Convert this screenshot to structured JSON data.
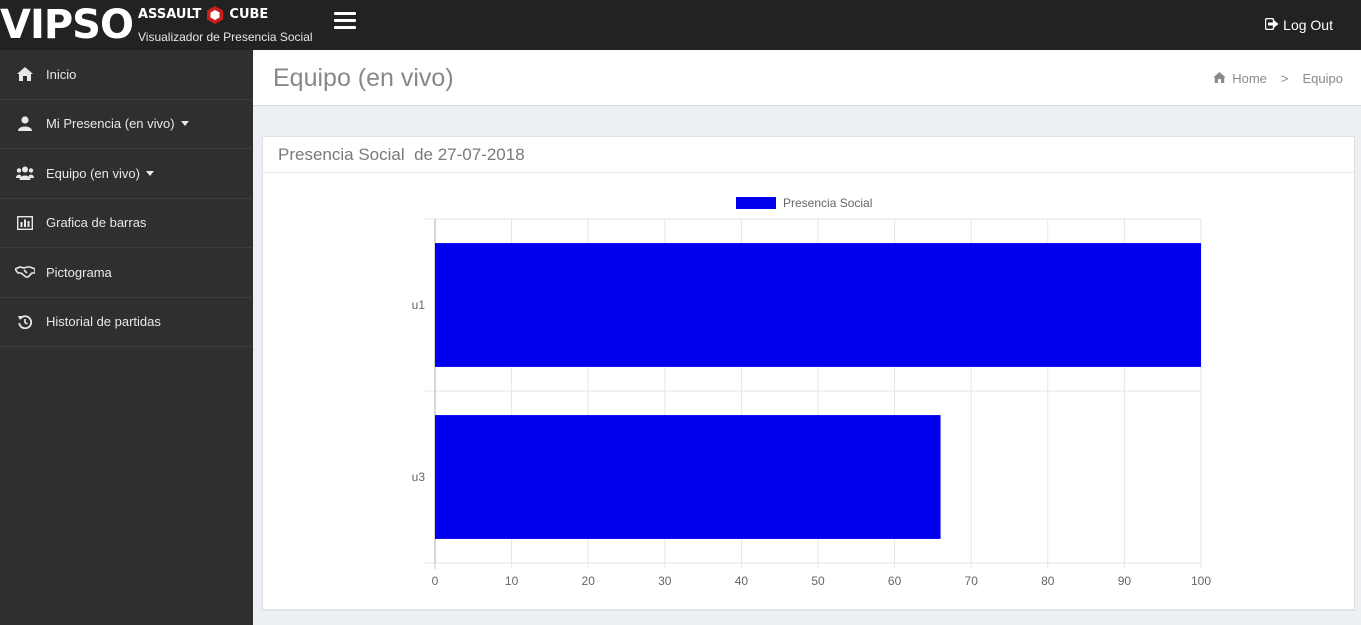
{
  "brand": {
    "logo_text": "VIPSO",
    "game_left": "ASSAULT",
    "game_right": "CUBE",
    "subtitle": "Visualizador de Presencia Social",
    "accent_color": "#cc1e1e"
  },
  "topbar": {
    "logout_label": "Log Out",
    "logout_icon": "sign-out-icon",
    "menu_icon": "hamburger-icon"
  },
  "sidebar": {
    "items": [
      {
        "label": "Inicio",
        "icon": "home-icon",
        "has_caret": false
      },
      {
        "label": "Mi Presencia (en vivo)",
        "icon": "user-icon",
        "has_caret": true
      },
      {
        "label": "Equipo (en vivo)",
        "icon": "users-icon",
        "has_caret": true
      },
      {
        "label": "Grafica de barras",
        "icon": "bar-chart-icon",
        "has_caret": false
      },
      {
        "label": "Pictograma",
        "icon": "handshake-icon",
        "has_caret": false
      },
      {
        "label": "Historial de partidas",
        "icon": "history-icon",
        "has_caret": false
      }
    ]
  },
  "header": {
    "title": "Equipo (en vivo)",
    "breadcrumb": {
      "home": "Home",
      "current": "Equipo",
      "separator": ">"
    }
  },
  "panel": {
    "title": "Presencia Social  de 27-07-2018"
  },
  "chart_data": {
    "type": "bar",
    "orientation": "horizontal",
    "categories": [
      "u1",
      "u3"
    ],
    "series": [
      {
        "name": "Presencia Social",
        "values": [
          100,
          66
        ],
        "color": "#0000ee"
      }
    ],
    "xlim": [
      0,
      100
    ],
    "xticks": [
      0,
      10,
      20,
      30,
      40,
      50,
      60,
      70,
      80,
      90,
      100
    ],
    "legend_position": "top-center",
    "grid": true
  }
}
